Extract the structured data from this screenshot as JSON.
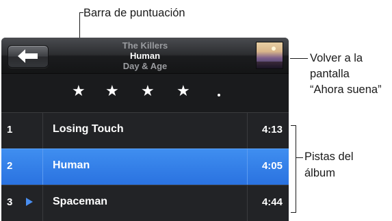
{
  "callouts": {
    "rating_bar": "Barra de puntuación",
    "now_playing_line1": "Volver a la",
    "now_playing_line2": "pantalla",
    "now_playing_line3": "“Ahora suena”",
    "tracks_line1": "Pistas del",
    "tracks_line2": "álbum"
  },
  "header": {
    "artist": "The Killers",
    "song": "Human",
    "album": "Day & Age",
    "artist_color": "#9a9ca0",
    "song_color": "#ffffff",
    "album_color": "#9a9ca0"
  },
  "rating": {
    "stars": 4,
    "max": 5
  },
  "tracks": [
    {
      "number": "1",
      "title": "Losing Touch",
      "duration": "4:13",
      "selected": false,
      "playing": false
    },
    {
      "number": "2",
      "title": "Human",
      "duration": "4:05",
      "selected": true,
      "playing": false
    },
    {
      "number": "3",
      "title": "Spaceman",
      "duration": "4:44",
      "selected": false,
      "playing": true
    }
  ],
  "colors": {
    "selected_row": "#2f7ae6",
    "play_indicator": "#4a8ef0"
  }
}
